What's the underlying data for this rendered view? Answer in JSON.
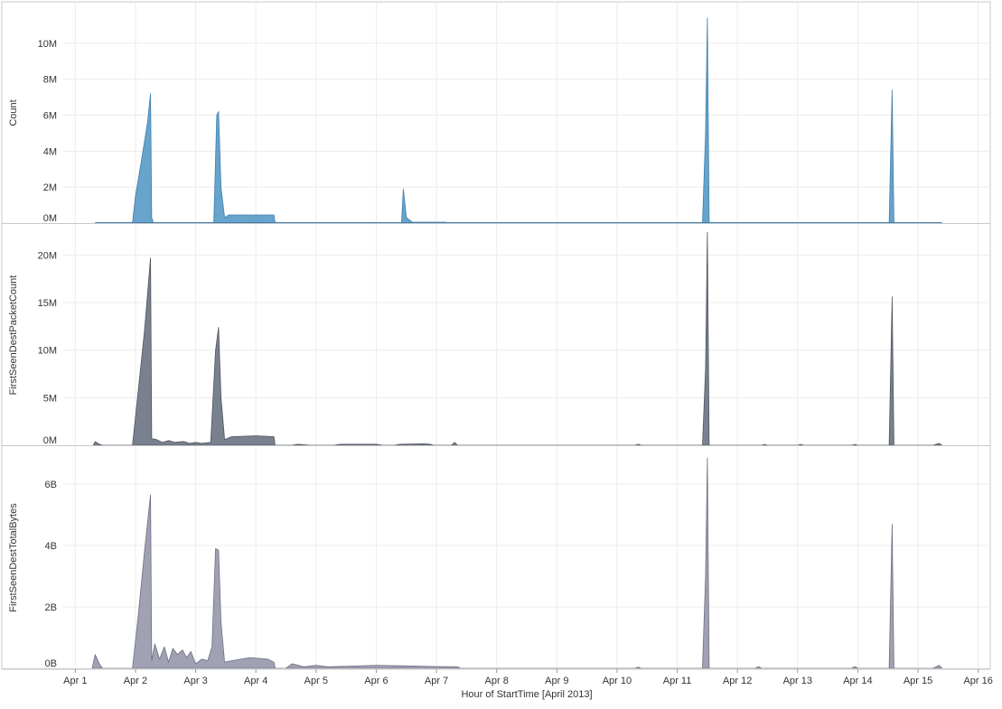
{
  "chart_data": {
    "type": "area",
    "x_title": "Hour of StartTime [April 2013]",
    "x_ticks": [
      "Apr 1",
      "Apr 2",
      "Apr 3",
      "Apr 4",
      "Apr 5",
      "Apr 6",
      "Apr 7",
      "Apr 8",
      "Apr 9",
      "Apr 10",
      "Apr 11",
      "Apr 12",
      "Apr 13",
      "Apr 14",
      "Apr 15",
      "Apr 16"
    ],
    "x_range_days": [
      0.8,
      16.2
    ],
    "grid": true,
    "panels": [
      {
        "name": "count",
        "ylabel": "Count",
        "color": "#5b9bc8",
        "stroke": "#3f7fae",
        "ylim": [
          0,
          12000000
        ],
        "tick_values": [
          0,
          2000000,
          4000000,
          6000000,
          8000000,
          10000000
        ],
        "tick_labels": [
          "0M",
          "2M",
          "4M",
          "6M",
          "8M",
          "10M"
        ],
        "points": [
          [
            1.33,
            0
          ],
          [
            1.95,
            0
          ],
          [
            2.0,
            1500000
          ],
          [
            2.1,
            3500000
          ],
          [
            2.2,
            5600000
          ],
          [
            2.25,
            7200000
          ],
          [
            2.27,
            300000
          ],
          [
            2.3,
            0
          ],
          [
            3.3,
            0
          ],
          [
            3.35,
            6000000
          ],
          [
            3.38,
            6200000
          ],
          [
            3.42,
            2000000
          ],
          [
            3.48,
            300000
          ],
          [
            3.55,
            450000
          ],
          [
            4.0,
            450000
          ],
          [
            4.3,
            450000
          ],
          [
            4.32,
            0
          ],
          [
            6.42,
            0
          ],
          [
            6.45,
            1900000
          ],
          [
            6.5,
            300000
          ],
          [
            6.6,
            50000
          ],
          [
            7.15,
            50000
          ],
          [
            7.2,
            0
          ],
          [
            11.42,
            0
          ],
          [
            11.47,
            5000000
          ],
          [
            11.5,
            11400000
          ],
          [
            11.53,
            0
          ],
          [
            14.52,
            0
          ],
          [
            14.57,
            7400000
          ],
          [
            14.6,
            0
          ],
          [
            15.4,
            0
          ]
        ]
      },
      {
        "name": "packets",
        "ylabel": "FirstSeenDestPacketCount",
        "color": "#6e7684",
        "stroke": "#4e5560",
        "ylim": [
          0,
          22500000
        ],
        "tick_values": [
          0,
          5000000,
          10000000,
          15000000,
          20000000
        ],
        "tick_labels": [
          "0M",
          "5M",
          "10M",
          "15M",
          "20M"
        ],
        "points": [
          [
            1.3,
            0
          ],
          [
            1.33,
            400000
          ],
          [
            1.4,
            100000
          ],
          [
            1.45,
            0
          ],
          [
            1.95,
            0
          ],
          [
            2.05,
            6000000
          ],
          [
            2.15,
            12000000
          ],
          [
            2.25,
            19700000
          ],
          [
            2.27,
            700000
          ],
          [
            2.35,
            600000
          ],
          [
            2.45,
            300000
          ],
          [
            2.55,
            500000
          ],
          [
            2.65,
            300000
          ],
          [
            2.8,
            400000
          ],
          [
            2.9,
            200000
          ],
          [
            3.0,
            300000
          ],
          [
            3.1,
            200000
          ],
          [
            3.25,
            300000
          ],
          [
            3.33,
            10000000
          ],
          [
            3.38,
            12400000
          ],
          [
            3.42,
            5000000
          ],
          [
            3.48,
            600000
          ],
          [
            3.6,
            900000
          ],
          [
            4.0,
            1000000
          ],
          [
            4.3,
            900000
          ],
          [
            4.32,
            0
          ],
          [
            4.6,
            0
          ],
          [
            4.7,
            100000
          ],
          [
            4.9,
            0
          ],
          [
            5.3,
            0
          ],
          [
            5.4,
            100000
          ],
          [
            6.0,
            100000
          ],
          [
            6.1,
            0
          ],
          [
            6.3,
            0
          ],
          [
            6.4,
            100000
          ],
          [
            6.8,
            150000
          ],
          [
            6.9,
            100000
          ],
          [
            6.95,
            0
          ],
          [
            7.25,
            0
          ],
          [
            7.3,
            300000
          ],
          [
            7.35,
            0
          ],
          [
            10.3,
            0
          ],
          [
            10.35,
            100000
          ],
          [
            10.4,
            0
          ],
          [
            11.42,
            0
          ],
          [
            11.47,
            8000000
          ],
          [
            11.5,
            22400000
          ],
          [
            11.53,
            0
          ],
          [
            12.4,
            0
          ],
          [
            12.45,
            80000
          ],
          [
            12.5,
            0
          ],
          [
            13.0,
            0
          ],
          [
            13.05,
            80000
          ],
          [
            13.1,
            0
          ],
          [
            13.9,
            0
          ],
          [
            13.95,
            80000
          ],
          [
            14.0,
            0
          ],
          [
            14.52,
            0
          ],
          [
            14.57,
            15600000
          ],
          [
            14.6,
            0
          ],
          [
            15.25,
            0
          ],
          [
            15.35,
            200000
          ],
          [
            15.4,
            0
          ]
        ]
      },
      {
        "name": "bytes",
        "ylabel": "FirstSeenDestTotalBytes",
        "color": "#989aad",
        "stroke": "#6d6f82",
        "ylim": [
          0,
          7000000000
        ],
        "tick_values": [
          0,
          2000000000,
          4000000000,
          6000000000
        ],
        "tick_labels": [
          "0B",
          "2B",
          "4B",
          "6B"
        ],
        "points": [
          [
            1.28,
            0
          ],
          [
            1.33,
            450000000
          ],
          [
            1.4,
            150000000
          ],
          [
            1.45,
            0
          ],
          [
            1.95,
            0
          ],
          [
            2.05,
            1800000000
          ],
          [
            2.15,
            3800000000
          ],
          [
            2.25,
            5650000000
          ],
          [
            2.27,
            250000000
          ],
          [
            2.32,
            800000000
          ],
          [
            2.4,
            300000000
          ],
          [
            2.48,
            700000000
          ],
          [
            2.55,
            200000000
          ],
          [
            2.62,
            650000000
          ],
          [
            2.7,
            450000000
          ],
          [
            2.78,
            600000000
          ],
          [
            2.85,
            350000000
          ],
          [
            2.92,
            550000000
          ],
          [
            3.0,
            150000000
          ],
          [
            3.1,
            300000000
          ],
          [
            3.2,
            250000000
          ],
          [
            3.27,
            700000000
          ],
          [
            3.33,
            3900000000
          ],
          [
            3.38,
            3850000000
          ],
          [
            3.42,
            1500000000
          ],
          [
            3.48,
            200000000
          ],
          [
            3.6,
            250000000
          ],
          [
            3.9,
            350000000
          ],
          [
            4.2,
            300000000
          ],
          [
            4.3,
            200000000
          ],
          [
            4.32,
            0
          ],
          [
            4.5,
            0
          ],
          [
            4.6,
            150000000
          ],
          [
            4.8,
            50000000
          ],
          [
            5.0,
            100000000
          ],
          [
            5.2,
            50000000
          ],
          [
            6.0,
            100000000
          ],
          [
            6.5,
            80000000
          ],
          [
            7.0,
            60000000
          ],
          [
            7.35,
            50000000
          ],
          [
            7.4,
            0
          ],
          [
            10.3,
            0
          ],
          [
            10.35,
            40000000
          ],
          [
            10.4,
            0
          ],
          [
            11.42,
            0
          ],
          [
            11.47,
            3000000000
          ],
          [
            11.5,
            6850000000
          ],
          [
            11.53,
            0
          ],
          [
            12.3,
            0
          ],
          [
            12.35,
            60000000
          ],
          [
            12.4,
            0
          ],
          [
            13.9,
            0
          ],
          [
            13.95,
            60000000
          ],
          [
            14.0,
            0
          ],
          [
            14.52,
            0
          ],
          [
            14.57,
            4700000000
          ],
          [
            14.6,
            0
          ],
          [
            15.25,
            0
          ],
          [
            15.35,
            100000000
          ],
          [
            15.4,
            0
          ]
        ]
      }
    ]
  }
}
